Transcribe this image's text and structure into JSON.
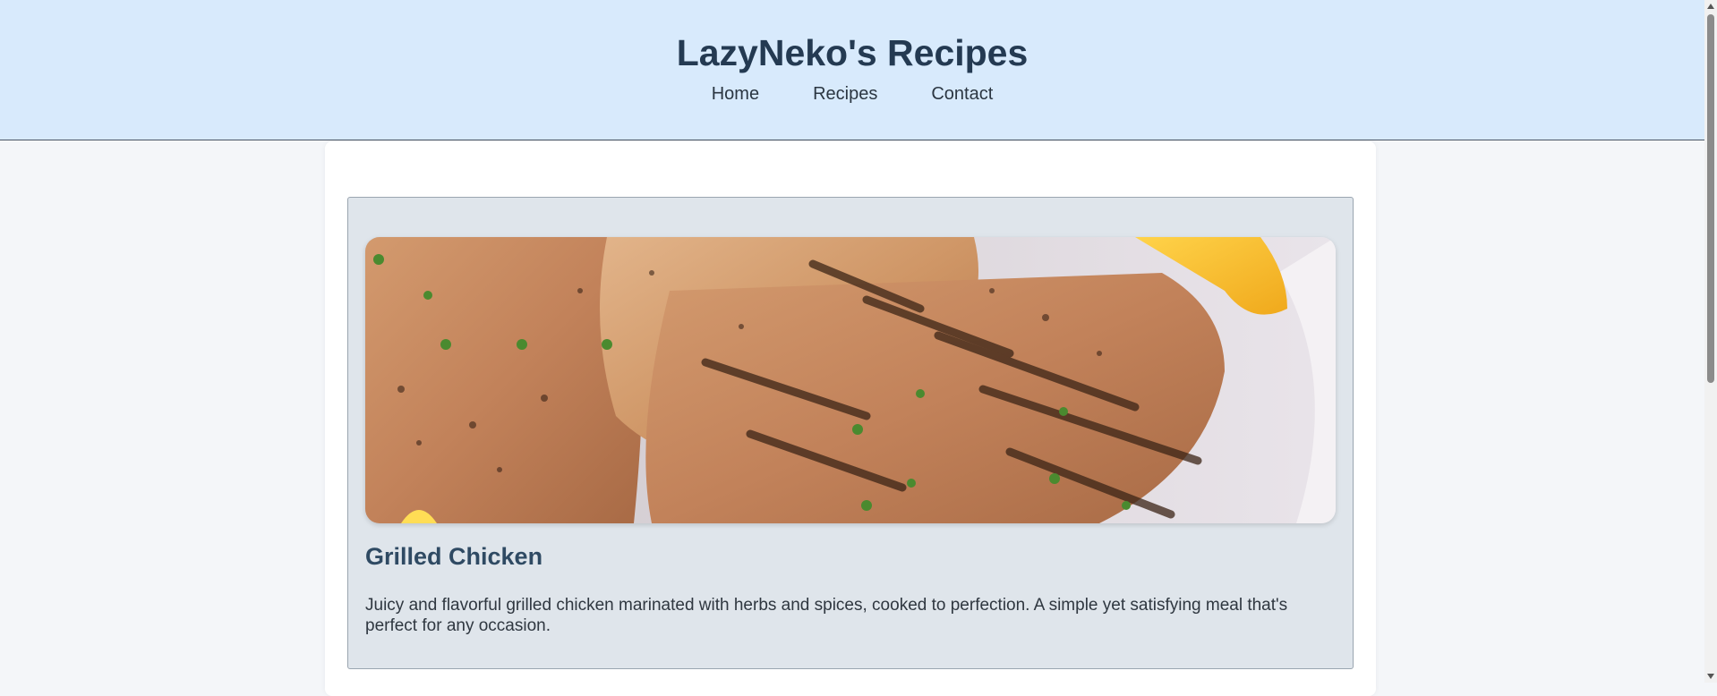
{
  "header": {
    "title": "LazyNeko's Recipes",
    "nav": [
      {
        "label": "Home"
      },
      {
        "label": "Recipes"
      },
      {
        "label": "Contact"
      }
    ]
  },
  "recipe": {
    "image_alt": "grilled-chicken-photo",
    "title": "Grilled Chicken",
    "description": "Juicy and flavorful grilled chicken marinated with herbs and spices, cooked to perfection. A simple yet satisfying meal that's perfect for any occasion."
  },
  "colors": {
    "header_bg": "#d8eafc",
    "title_color": "#243a52",
    "card_bg": "#dfe5eb",
    "recipe_title_color": "#2f4a63"
  }
}
